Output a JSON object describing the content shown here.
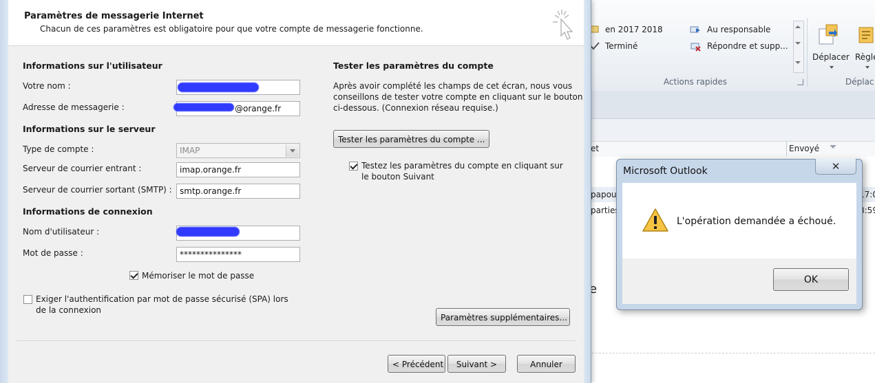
{
  "outlook": {
    "quick_steps": [
      "en 2017 2018",
      "Au responsable",
      "Terminé",
      "Répondre et supp..."
    ],
    "group_label": "Actions rapides",
    "move_button": "Déplacer",
    "rules_button": "Règle",
    "move_group_label": "Déplac",
    "column_subject": "et",
    "column_sent": "Envoyé",
    "rows": [
      {
        "subject": "papou",
        "time": "17:0"
      },
      {
        "subject": "parties",
        "time": "8:59"
      }
    ],
    "stray_char": "e"
  },
  "dialog": {
    "title": "Paramètres de messagerie Internet",
    "subtitle": "Chacun de ces paramètres est obligatoire pour que votre compte de messagerie fonctionne.",
    "user_section": "Informations sur l'utilisateur",
    "name_label": "Votre nom :",
    "name_value": "",
    "email_label": "Adresse de messagerie :",
    "email_value": "@orange.fr",
    "server_section": "Informations sur le serveur",
    "account_type_label": "Type de compte :",
    "account_type_value": "IMAP",
    "incoming_label": "Serveur de courrier entrant :",
    "incoming_value": "imap.orange.fr",
    "outgoing_label": "Serveur de courrier sortant (SMTP) :",
    "outgoing_value": "smtp.orange.fr",
    "login_section": "Informations de connexion",
    "username_label": "Nom d'utilisateur :",
    "username_value": "",
    "password_label": "Mot de passe :",
    "password_value": "***************",
    "remember_password": "Mémoriser le mot de passe",
    "spa_line1": "Exiger l'authentification par mot de passe sécurisé (SPA) lors",
    "spa_line2": "de la connexion",
    "test_section": "Tester les paramètres du compte",
    "test_para_1": "Après avoir complété les champs de cet écran, nous vous",
    "test_para_2": "conseillons de tester votre compte en cliquant sur le bouton",
    "test_para_3": "ci-dessous. (Connexion réseau requise.)",
    "test_button": "Tester les paramètres du compte ...",
    "test_next_line1": "Testez les paramètres du compte en cliquant sur",
    "test_next_line2": "le bouton Suivant",
    "more_settings": "Paramètres supplémentaires...",
    "back": "< Précédent",
    "next": "Suivant >",
    "cancel": "Annuler"
  },
  "alert": {
    "title": "Microsoft Outlook",
    "close": "✕",
    "message": "L'opération demandée a échoué.",
    "ok": "OK"
  },
  "colors": {
    "accent": "#1f2bff",
    "dialog_bg": "#f0f0f0",
    "alert_frame": "#c7d7ea"
  }
}
